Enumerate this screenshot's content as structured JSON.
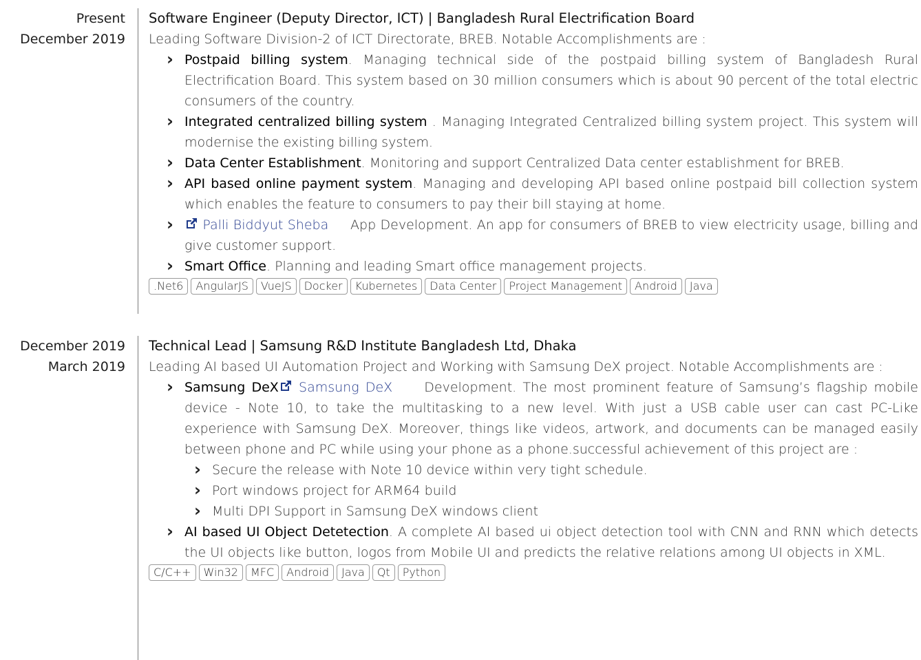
{
  "entries": [
    {
      "date_end": "Present",
      "date_start": "December 2019",
      "title": "Software Engineer (Deputy Director, ICT) | Bangladesh Rural Electrification Board",
      "description": "Leading Software Division-2 of ICT Directorate, BREB. Notable Accomplishments are :",
      "items": [
        {
          "head": "Postpaid billing system",
          "text": ". Managing technical side of the postpaid billing system of Bangladesh Rural Electrification Board. This system based on 30 million consumers which is about 90 percent of the total electric consumers of the country."
        },
        {
          "head": " Integrated centralized billing system ",
          "text": ". Managing Integrated Centralized billing system project. This system will modernise the existing billing system."
        },
        {
          "head": "Data Center Establishment",
          "text": ". Monitoring and support Centralized Data center establishment for BREB."
        },
        {
          "head": "API based online payment system",
          "text": ". Managing and developing API based online postpaid bill collection system which enables the feature to consumers to pay their bill staying at home."
        },
        {
          "link": "Palli Biddyut Sheba",
          "text": " App Development. An app for consumers of BREB to view electricity usage, billing and give customer support."
        },
        {
          "head": "Smart Office",
          "text": ". Planning and leading Smart office management projects."
        }
      ],
      "tags": [
        ".Net6",
        "AngularJS",
        "VueJS",
        "Docker",
        "Kubernetes",
        "Data Center",
        "Project Management",
        "Android",
        "Java"
      ]
    },
    {
      "date_end": "December 2019",
      "date_start": "March 2019",
      "title": "Technical Lead | Samsung R&D Institute Bangladesh Ltd, Dhaka",
      "description": "Leading AI based UI Automation Project and Working with Samsung DeX project. Notable Accomplishments are :",
      "items": [
        {
          "head": "Samsung DeX",
          "link": "Samsung DeX",
          "text": " Development. The most prominent feature of Samsung’s flagship mobile device - Note 10, to take the multitasking to a new level. With just a USB cable user can cast PC-Like experience with Samsung DeX. Moreover, things like videos, artwork, and documents can be managed easily between phone and PC while using your phone as a phone.successful achievement of this project are :",
          "sub": [
            "Secure the release with Note 10 device within very tight schedule.",
            "Port windows project for ARM64 build",
            "Multi DPI Support in Samsung DeX windows client"
          ]
        },
        {
          "head": "AI based UI Object Detetection",
          "text": ". A complete AI based ui object detection tool with CNN and RNN which detects the UI objects like button, logos from Mobile UI and predicts the relative relations among UI objects in XML."
        }
      ],
      "tags": [
        "C/C++",
        "Win32",
        "MFC",
        "Android",
        "Java",
        "Qt",
        "Python"
      ]
    }
  ]
}
